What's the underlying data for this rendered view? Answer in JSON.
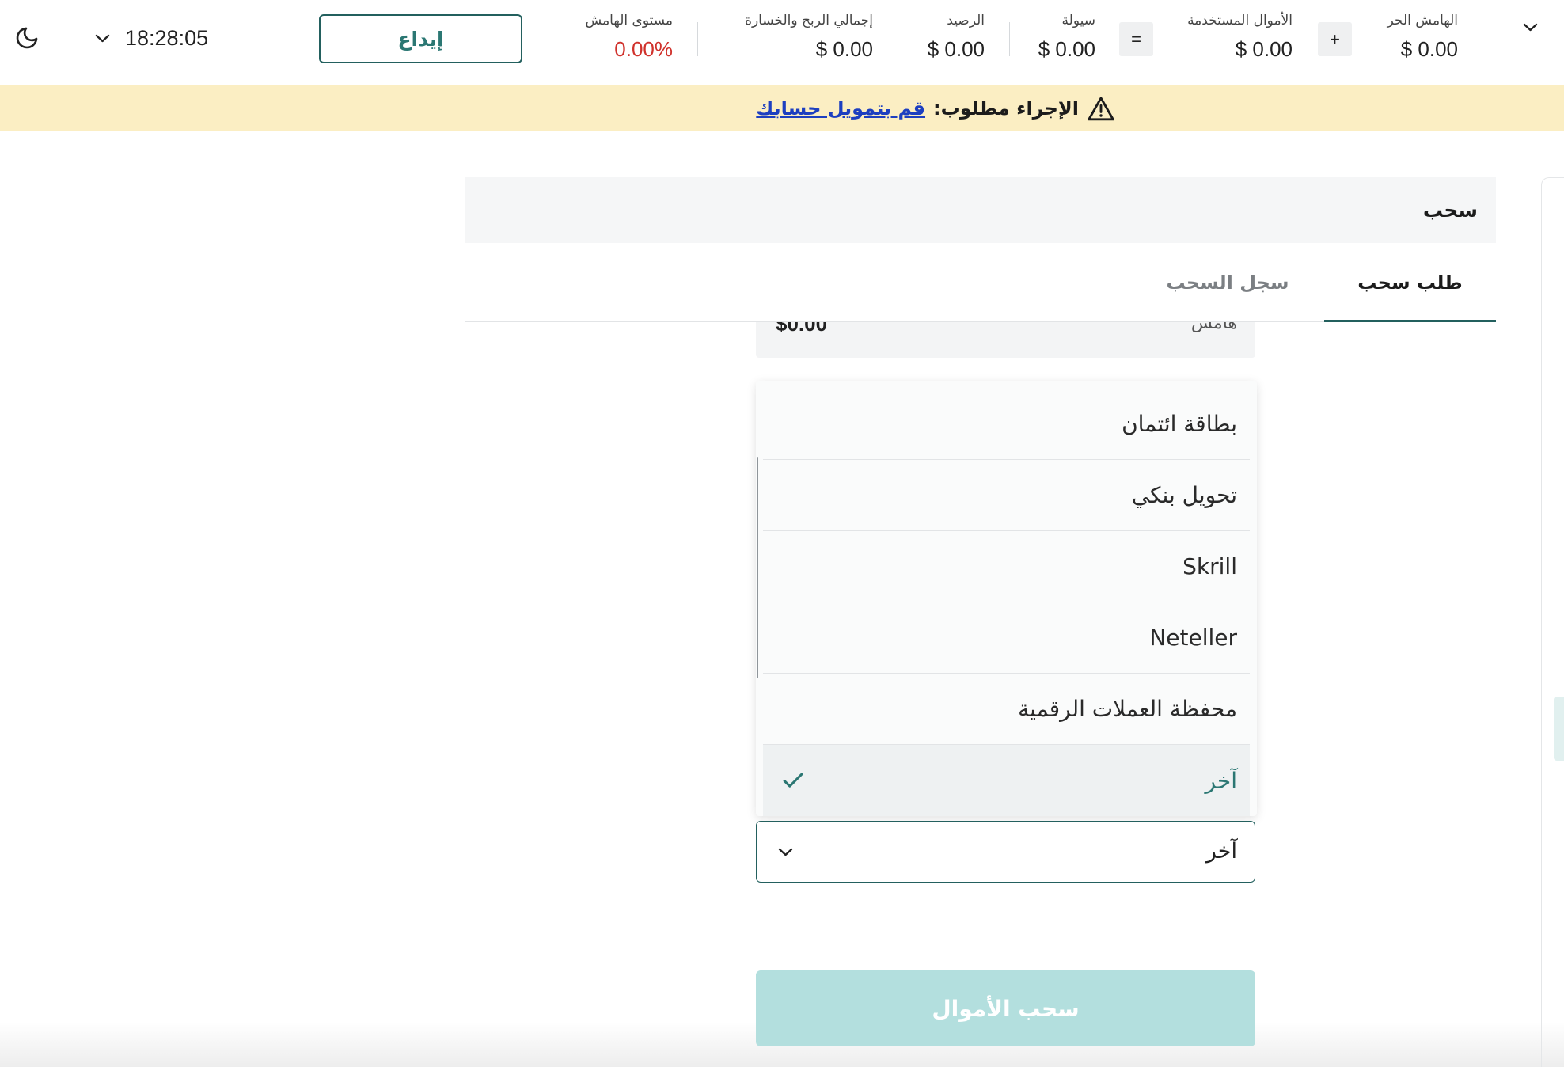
{
  "colors": {
    "accent": "#2b7773",
    "accent_dark": "#23605e",
    "negative": "#d0322c",
    "warning_bg": "#fbeec3",
    "link": "#1d3fc0",
    "button_disabled_bg": "#b3dfde",
    "selected_option_bg": "#eef1f2"
  },
  "header": {
    "theme_toggle_icon": "moon-icon",
    "time": "18:28:05",
    "time_dropdown_icon": "chevron-down-icon",
    "deposit_label": "إيداع",
    "margin_level": {
      "label": "مستوى الهامش",
      "value": "0.00%"
    },
    "total_pnl": {
      "label": "إجمالي الربح والخسارة",
      "value": "$ 0.00"
    },
    "balance": {
      "label": "الرصيد",
      "value": "$ 0.00"
    },
    "equity": {
      "label": "سيولة",
      "value": "$ 0.00"
    },
    "equals_sign": "=",
    "used_margin": {
      "label": "الأموال المستخدمة",
      "value": "$ 0.00"
    },
    "plus_sign": "+",
    "free_margin": {
      "label": "الهامش الحر",
      "value": "$ 0.00"
    },
    "collapse_icon": "chevron-down-icon"
  },
  "banner": {
    "icon": "warning-icon",
    "message": "الإجراء مطلوب:",
    "link_text": "قم بتمويل حسابك"
  },
  "withdraw_panel": {
    "title": "سحب",
    "tabs": [
      {
        "label": "طلب سحب",
        "active": true
      },
      {
        "label": "سجل السحب",
        "active": false
      }
    ],
    "margin_field": {
      "label": "هامش",
      "value": "$0.00"
    },
    "method_dropdown": {
      "options": [
        {
          "label": "بطاقة ائتمان",
          "selected": false
        },
        {
          "label": "تحويل بنكي",
          "selected": false
        },
        {
          "label": "Skrill",
          "selected": false
        },
        {
          "label": "Neteller",
          "selected": false
        },
        {
          "label": "محفظة العملات الرقمية",
          "selected": false
        },
        {
          "label": "آخر",
          "selected": true
        }
      ],
      "selected_icon": "check-icon"
    },
    "method_select": {
      "value": "آخر",
      "icon": "chevron-down-icon"
    },
    "submit_label": "سحب الأموال"
  }
}
